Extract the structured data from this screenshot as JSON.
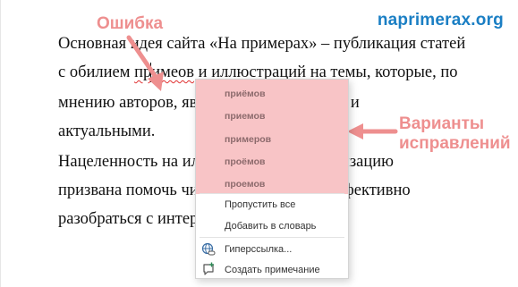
{
  "watermark": "naprimerax.org",
  "annotations": {
    "error": "Ошибка",
    "variants_line1": "Варианты",
    "variants_line2": "исправлений"
  },
  "document": {
    "line1": "Основная идея сайта «На примерах» – публикация статей",
    "line2_before": "с обилием ",
    "line2_misspelled": "примеов",
    "line2_after": " и иллюстраций на темы, которые, по",
    "line3": "мнению авторов, являются интересными и",
    "line4": "актуальными.",
    "line5": "Нацеленность на иллюстрации и визуализацию",
    "line6": "призвана помочь читателям быстро и эффективно",
    "line7": "разобраться с интересующим вопросом."
  },
  "context_menu": {
    "suggestions": [
      "приёмов",
      "приемов",
      "примеров",
      "проёмов",
      "проемов"
    ],
    "ignore_all": "Пропустить все",
    "add_to_dictionary": "Добавить в словарь",
    "hyperlink": "Гиперссылка...",
    "new_comment": "Создать примечание"
  },
  "colors": {
    "annotation": "#ee8f8f",
    "suggestion_highlight": "#f8c4c6",
    "watermark": "#1b7fc4",
    "spelling_underline": "#e03030"
  }
}
